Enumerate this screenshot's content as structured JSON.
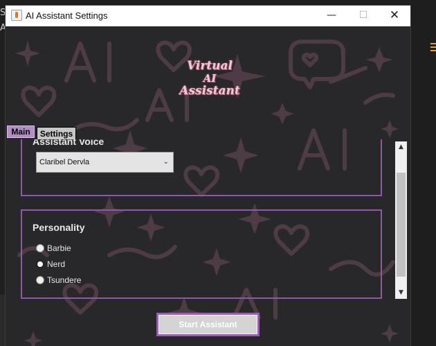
{
  "window": {
    "title": "AI Assistant Settings"
  },
  "titlebar_controls": {
    "minimize": "—",
    "maximize": "☐",
    "close": "✕"
  },
  "host": {
    "left_glyphs": "S\nA"
  },
  "logo": {
    "line1": "Virtual",
    "line2": "AI",
    "line3": "Assistant"
  },
  "tabs": [
    {
      "label": "Main",
      "selected": true
    },
    {
      "label": "Settings",
      "selected": false
    }
  ],
  "voice": {
    "title": "Assistant Voice",
    "selected": "Claribel Dervla"
  },
  "personality": {
    "title": "Personality",
    "options": [
      {
        "label": "Barbie",
        "selected": false
      },
      {
        "label": "Nerd",
        "selected": true
      },
      {
        "label": "Tsundere",
        "selected": false
      }
    ]
  },
  "start_button": {
    "label": "Start Assistant"
  },
  "colors": {
    "accent": "#8e5aa8",
    "background": "#28282b",
    "decor": "#5a434f"
  },
  "icons": {
    "app": "java-icon",
    "dropdown": "chevron-down-icon",
    "scroll_up": "arrow-up-icon",
    "scroll_down": "arrow-down-icon"
  }
}
